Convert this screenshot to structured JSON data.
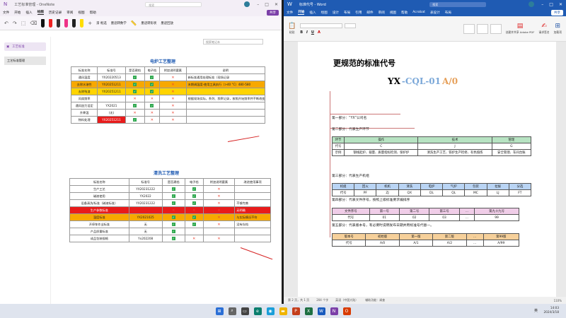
{
  "left_window": {
    "title": "工艺标准管理 - OneNote",
    "search_placeholder": "搜索",
    "menu": [
      "文件",
      "开始",
      "插入",
      "绘图",
      "历史记录",
      "审阅",
      "视图",
      "帮助"
    ],
    "active_menu": "绘图",
    "share": "共享",
    "ribbon": {
      "lasso": "漆 框选",
      "convert_math": "墨迹转数学",
      "ink_to_shape": "墨迹转形状",
      "replay": "墨迹回放"
    },
    "nav": {
      "notebook": "工艺标准",
      "page": "工艺标准管理"
    },
    "page_search": "搜索笔记本",
    "table1": {
      "title": "电炉工艺整理",
      "headers": [
        "标准名称",
        "标准号",
        "是否建档",
        "电子档",
        "附加说明要素",
        "说明"
      ],
      "rows": [
        {
          "name": "通风温度",
          "code": "YX20220513",
          "c1": "check",
          "c2": "check",
          "c3": "x",
          "note": "新标准通用处理标准（现场记录",
          "style": ""
        },
        {
          "name": "去除水溶性",
          "code": "YX20251211",
          "c1": "check",
          "c2": "check",
          "c3": "x",
          "note": "末期调温度-使用工具执行（>40 °C）480-580",
          "style": "orange"
        },
        {
          "name": "去除残渣",
          "code": "YX20251211",
          "c1": "check",
          "c2": "check",
          "c3": "x",
          "note": "",
          "style": "yellow"
        },
        {
          "name": "风扇频率",
          "code": "",
          "c1": "x",
          "c2": "x",
          "c3": "x",
          "note": "根据现场实际，系列、频率记录，按照开始频率并不断改变",
          "style": ""
        },
        {
          "name": "通风加力设定",
          "code": "YX2021",
          "c1": "check",
          "c2": "check",
          "c3": "x",
          "note": "",
          "style": ""
        },
        {
          "name": "升降温",
          "code": "(无)",
          "c1": "x",
          "c2": "x",
          "c3": "x",
          "note": "",
          "style": ""
        },
        {
          "name": "物料处理",
          "code": "YX20251211",
          "c1": "check",
          "c2": "x",
          "c3": "x",
          "note": "",
          "style": "redcode"
        }
      ]
    },
    "table2": {
      "title": "清洗工艺整理",
      "headers": [
        "标准名称",
        "标准号",
        "是否建档",
        "电子档",
        "附加说明要素",
        "改进使用事项"
      ],
      "rows": [
        {
          "name": "生产工艺",
          "code": "YX20231222",
          "c1": "check",
          "c2": "check",
          "c3": "x",
          "note": "",
          "style": ""
        },
        {
          "name": "碱液使用",
          "code": "YX2022",
          "c1": "check",
          "c2": "check",
          "c3": "x",
          "note": "",
          "style": ""
        },
        {
          "name": "设备清洗/标准（碱液标准）",
          "code": "YX20231222",
          "c1": "check",
          "c2": "check",
          "c3": "x",
          "note": "不够完善",
          "style": ""
        },
        {
          "name": "生产参数标准",
          "code": "",
          "c1": "x",
          "c2": "x",
          "c3": "x",
          "note": "无明确",
          "style": "red"
        },
        {
          "name": "温度标准",
          "code": "YX2021025",
          "c1": "check",
          "c2": "check",
          "c3": "x",
          "note": "与实际情况不符",
          "style": "orange"
        },
        {
          "name": "开停车作业标准",
          "code": "无",
          "c1": "check",
          "c2": "check",
          "c3": "x",
          "note": "没有存档",
          "style": ""
        },
        {
          "name": "产品质量标准",
          "code": "无",
          "c1": "check",
          "c2": "",
          "c3": "",
          "note": "",
          "style": ""
        },
        {
          "name": "成品包装规格",
          "code": "Yx202208",
          "c1": "check",
          "c2": "x",
          "c3": "x",
          "note": "",
          "style": ""
        }
      ]
    }
  },
  "right_window": {
    "title": "标准代号 - Word",
    "search_placeholder": "搜索",
    "menu": [
      "文件",
      "开始",
      "插入",
      "绘图",
      "设计",
      "布局",
      "引用",
      "邮件",
      "审阅",
      "视图",
      "帮助",
      "Acrobat",
      "表设计",
      "布局"
    ],
    "active_menu": "开始",
    "share": "共享",
    "ribbon": {
      "paste": "粘贴",
      "pdf": "创建并共享 Adobe PDF",
      "signature": "请求签名",
      "addins": "加载项",
      "acrobat": "Adobe Acrobat"
    },
    "doc": {
      "heading": "更规范的标准代号",
      "code_parts": [
        {
          "text": "YX",
          "color": "#000000"
        },
        {
          "text": "-CQL-01",
          "color": "#7aa7d8"
        },
        {
          "text": "A/0",
          "color": "#e6a05a"
        }
      ],
      "parts": [
        "第一部分：“YX”公司名",
        "第二部分：代表生产环节",
        "第三部分：代表生产机组",
        "第四部分：代表文件序号，按照上级标准要求编排序",
        "第五部分：代表版本号，有必要时说明发布日期并用标准号代替—。"
      ],
      "table1": {
        "headers": [
          "环节",
          "操作",
          "技术",
          "管理"
        ],
        "rows": [
          [
            "代号",
            "C",
            "J",
            "G"
          ],
          [
            "示例",
            "钢线起炉、裁量、质量指标检测、保护炉",
            "清洗生产工艺、铁炉生产检修、有色熔炼",
            "安全管理、车间台账"
          ]
        ]
      },
      "table2": {
        "headers": [
          "机组",
          "回火",
          "机机",
          "清洗",
          "电炉",
          "气炉",
          "包装",
          "拉拔",
          "分选"
        ],
        "rows": [
          [
            "代号",
            "PF",
            "ZJ",
            "QX",
            "DL",
            "QL",
            "MC",
            "LJ",
            "FT"
          ]
        ]
      },
      "table3": {
        "headers": [
          "文件序号",
          "第一号",
          "第二号",
          "第三号",
          "...",
          "第九十九号"
        ],
        "rows": [
          [
            "代号",
            "01",
            "02",
            "03",
            "...",
            "99"
          ]
        ]
      },
      "table4": {
        "headers": [
          "版本号",
          "初始版",
          "第一版",
          "第二版",
          "...",
          "第99版"
        ],
        "rows": [
          [
            "代号",
            "A/0",
            "A/1",
            "A/2",
            "...",
            "A/99"
          ]
        ]
      }
    },
    "status": {
      "page": "第 2 页，共 1 页",
      "words": "204 个字",
      "lang": "英语（中国大陆）",
      "acc": "辅助功能：调查",
      "zoom": "110%"
    }
  },
  "taskbar": {
    "time": "14:03",
    "date": "2024/3/18",
    "tray": "英"
  },
  "colors": {
    "onenote": "#7b3fa8",
    "word": "#1f5bb3",
    "check": "#2fa84f"
  }
}
